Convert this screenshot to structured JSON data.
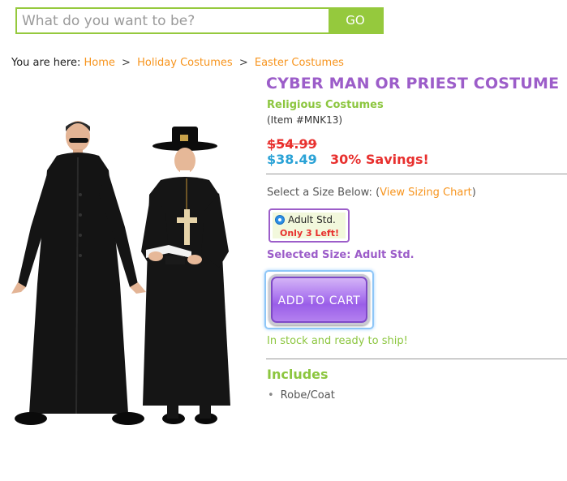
{
  "search": {
    "placeholder": "What do you want to be?",
    "button_label": "GO"
  },
  "breadcrumb": {
    "prefix": "You are here:",
    "items": [
      "Home",
      "Holiday Costumes",
      "Easter Costumes"
    ],
    "separator": ">"
  },
  "product": {
    "title": "CYBER MAN OR PRIEST COSTUME",
    "category": "Religious Costumes",
    "item_number": "(Item #MNK13)",
    "old_price": "$54.99",
    "new_price": "$38.49",
    "savings": "30% Savings!",
    "size_prompt_prefix": "Select a Size Below: (",
    "size_chart_link": "View Sizing Chart",
    "size_prompt_suffix": ")",
    "size_option": {
      "label": "Adult Std.",
      "stock_note": "Only 3 Left!"
    },
    "selected_size": "Selected Size: Adult Std.",
    "add_to_cart_label": "ADD TO CART",
    "stock_status": "In stock and ready to ship!",
    "includes_heading": "Includes",
    "includes": [
      "Robe/Coat"
    ]
  },
  "colors": {
    "accent_green": "#95c93d",
    "title_purple": "#9c5dc9",
    "link_orange": "#f7941d",
    "price_red": "#e8302e",
    "price_blue": "#2aa2d6"
  }
}
